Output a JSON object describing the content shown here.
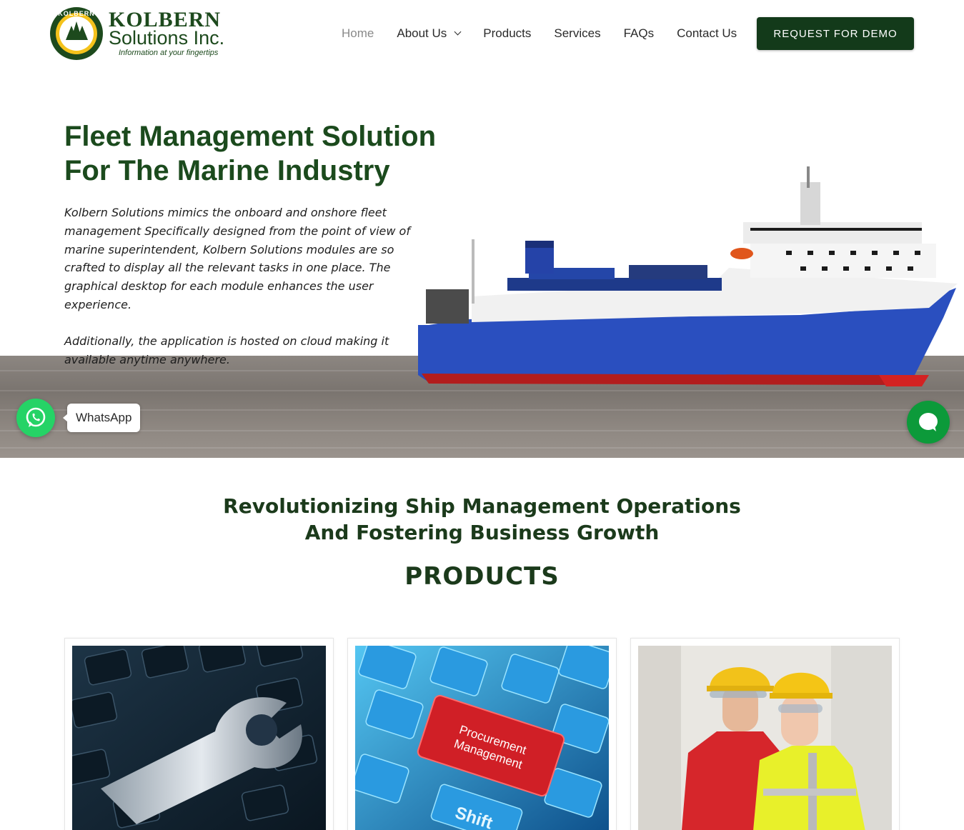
{
  "brand": {
    "seal_text": "KOLBERN",
    "name": "KOLBERN",
    "subname": "Solutions Inc.",
    "tagline": "Information at your fingertips"
  },
  "nav": {
    "items": [
      {
        "label": "Home",
        "active": true
      },
      {
        "label": "About Us",
        "has_dropdown": true
      },
      {
        "label": "Products"
      },
      {
        "label": "Services"
      },
      {
        "label": "FAQs"
      },
      {
        "label": "Contact Us"
      }
    ],
    "cta": "REQUEST FOR DEMO"
  },
  "hero": {
    "title": "Fleet Management Solution For The Marine Industry",
    "paragraph_1": "Kolbern Solutions mimics the onboard and onshore fleet management Specifically designed from the point of view of marine superintendent, Kolbern Solutions modules are so crafted to display all the relevant tasks in one place. The graphical desktop for each module enhances the user experience.",
    "paragraph_2": "Additionally, the application is hosted on cloud making it available anytime anywhere."
  },
  "whatsapp": {
    "label": "WhatsApp"
  },
  "section": {
    "headline": "Revolutionizing Ship Management Operations And Fostering Business Growth",
    "products_heading": "PRODUCTS"
  },
  "products": [
    {
      "image": "wrench-on-keyboard"
    },
    {
      "image": "procurement-key",
      "key_text_1": "Procurement",
      "key_text_2": "Management",
      "shift_label": "Shift"
    },
    {
      "image": "workers-hardhats"
    }
  ],
  "colors": {
    "brand_green": "#1b4a1d",
    "cta_bg": "#133a1a",
    "whatsapp": "#25d366",
    "chat": "#0c9a3a",
    "hull_blue": "#2a4fbf"
  }
}
